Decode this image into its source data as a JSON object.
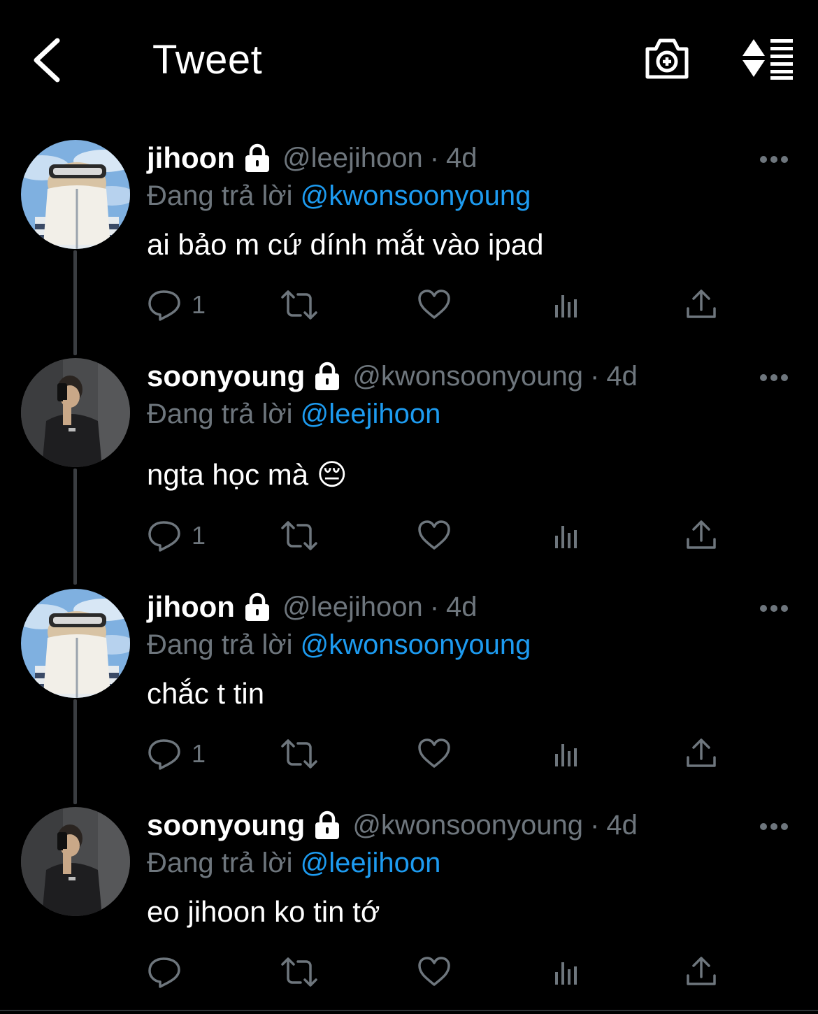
{
  "header": {
    "back_icon": "chevron-left-icon",
    "title": "Tweet",
    "camera_icon": "camera-plus-icon",
    "sort_icon": "sort-arrows-list-icon"
  },
  "colors": {
    "background": "#000000",
    "text": "#ffffff",
    "muted": "#6e767d",
    "mention": "#1d9bf0",
    "thread_line": "#3a3d41"
  },
  "thread": [
    {
      "name": "jihoon",
      "handle": "@leejihoon",
      "sep": "·",
      "time": "4d",
      "reply_prefix": "Đang trả lời",
      "reply_to": "@kwonsoonyoung",
      "text": "ai bảo m cứ dính mắt vào ipad",
      "reply_count": "1"
    },
    {
      "name": "soonyoung",
      "handle": "@kwonsoonyoung",
      "sep": "·",
      "time": "4d",
      "reply_prefix": "Đang trả lời",
      "reply_to": "@leejihoon",
      "text": "ngta học mà 😔",
      "reply_count": "1"
    },
    {
      "name": "jihoon",
      "handle": "@leejihoon",
      "sep": "·",
      "time": "4d",
      "reply_prefix": "Đang trả lời",
      "reply_to": "@kwonsoonyoung",
      "text": "chắc t tin",
      "reply_count": "1"
    },
    {
      "name": "soonyoung",
      "handle": "@kwonsoonyoung",
      "sep": "·",
      "time": "4d",
      "reply_prefix": "Đang trả lời",
      "reply_to": "@leejihoon",
      "text": "eo jihoon ko tin tớ",
      "reply_count": ""
    }
  ]
}
